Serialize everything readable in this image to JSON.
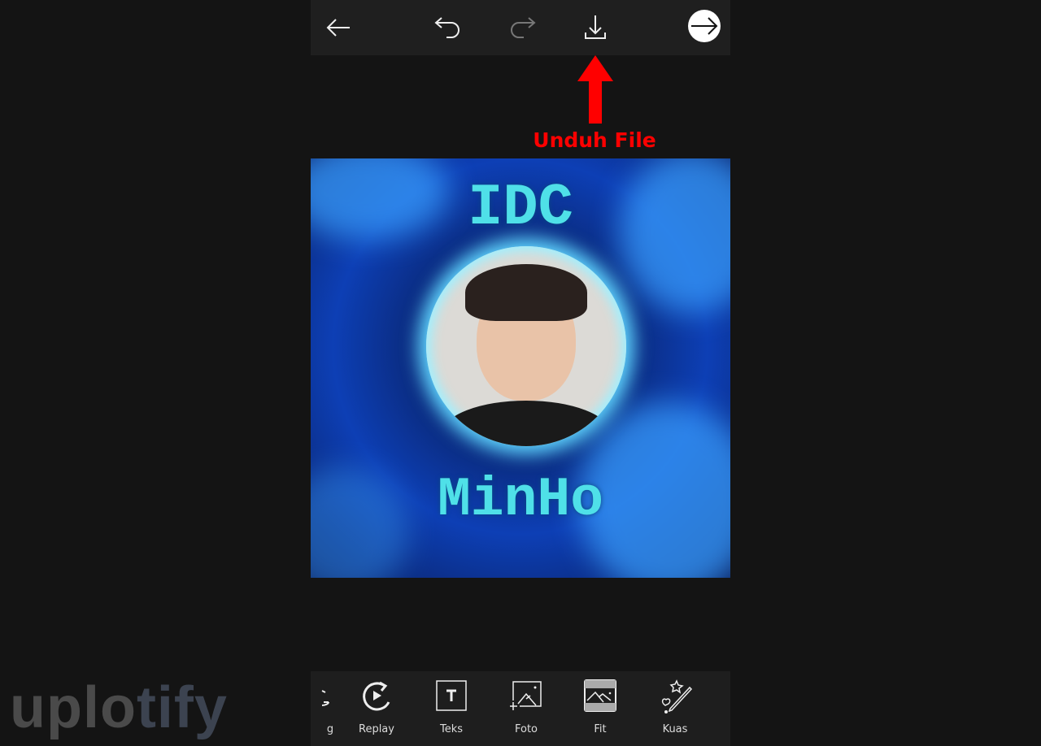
{
  "topbar": {
    "icons": [
      "back-arrow-icon",
      "undo-icon",
      "redo-icon",
      "download-icon",
      "next-arrow-icon"
    ]
  },
  "annotation": {
    "label": "Unduh File",
    "color": "#ff0000"
  },
  "canvas": {
    "top_text": "IDC",
    "bottom_text": "MinHo",
    "text_color": "#4fe0e8"
  },
  "toolbar": {
    "items": [
      {
        "label": "g",
        "icon": "partial-icon"
      },
      {
        "label": "Replay",
        "icon": "replay-icon"
      },
      {
        "label": "Teks",
        "icon": "text-icon"
      },
      {
        "label": "Foto",
        "icon": "add-photo-icon"
      },
      {
        "label": "Fit",
        "icon": "fit-icon"
      },
      {
        "label": "Kuas",
        "icon": "brush-icon"
      }
    ]
  },
  "watermark": {
    "part1": "uplo",
    "part2": "tify",
    "color1": "#4a4a4a",
    "color2": "#3c4350"
  }
}
